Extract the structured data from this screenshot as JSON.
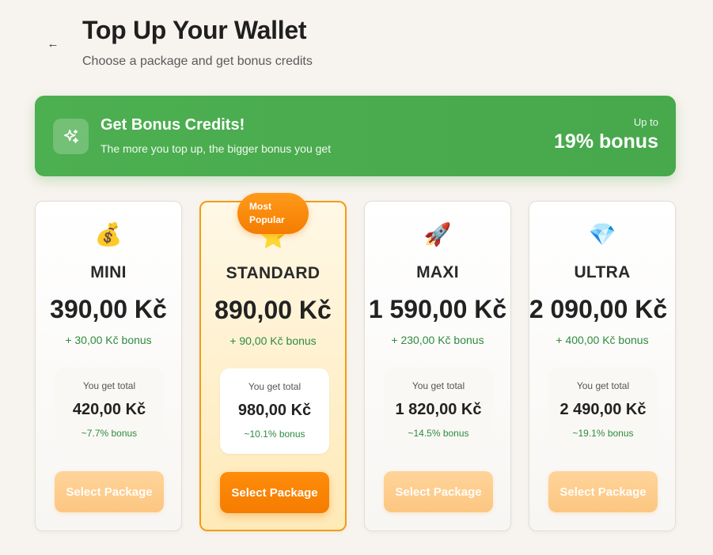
{
  "header": {
    "back_icon": "arrow-left-icon",
    "title": "Top Up Your Wallet",
    "subtitle": "Choose a package and get bonus credits"
  },
  "banner": {
    "icon": "sparkles-icon",
    "title": "Get Bonus Credits!",
    "description": "The more you top up, the bigger bonus you get",
    "upto_label": "Up to",
    "max_bonus": "19% bonus",
    "color": "#4caf50"
  },
  "packages": [
    {
      "icon": "money-bag-icon",
      "emoji": "💰",
      "name": "MINI",
      "price": "390,00 Kč",
      "bonus": "+ 30,00 Kč bonus",
      "total_label": "You get total",
      "total": "420,00 Kč",
      "bonus_pct": "~7.7% bonus",
      "button": "Select Package"
    },
    {
      "icon": "star-icon",
      "emoji": "⭐",
      "name": "STANDARD",
      "price": "890,00 Kč",
      "bonus": "+ 90,00 Kč bonus",
      "total_label": "You get total",
      "total": "980,00 Kč",
      "bonus_pct": "~10.1% bonus",
      "button": "Select Package",
      "badge": "Most Popular"
    },
    {
      "icon": "rocket-icon",
      "emoji": "🚀",
      "name": "MAXI",
      "price": "1 590,00 Kč",
      "bonus": "+ 230,00 Kč bonus",
      "total_label": "You get total",
      "total": "1 820,00 Kč",
      "bonus_pct": "~14.5% bonus",
      "button": "Select Package"
    },
    {
      "icon": "diamond-icon",
      "emoji": "💎",
      "name": "ULTRA",
      "price": "2 090,00 Kč",
      "bonus": "+ 400,00 Kč bonus",
      "total_label": "You get total",
      "total": "2 490,00 Kč",
      "bonus_pct": "~19.1% bonus",
      "button": "Select Package"
    }
  ],
  "colors": {
    "accent": "#f57c00",
    "bonus_green": "#2e8b3e",
    "background": "#f7f3ee"
  }
}
